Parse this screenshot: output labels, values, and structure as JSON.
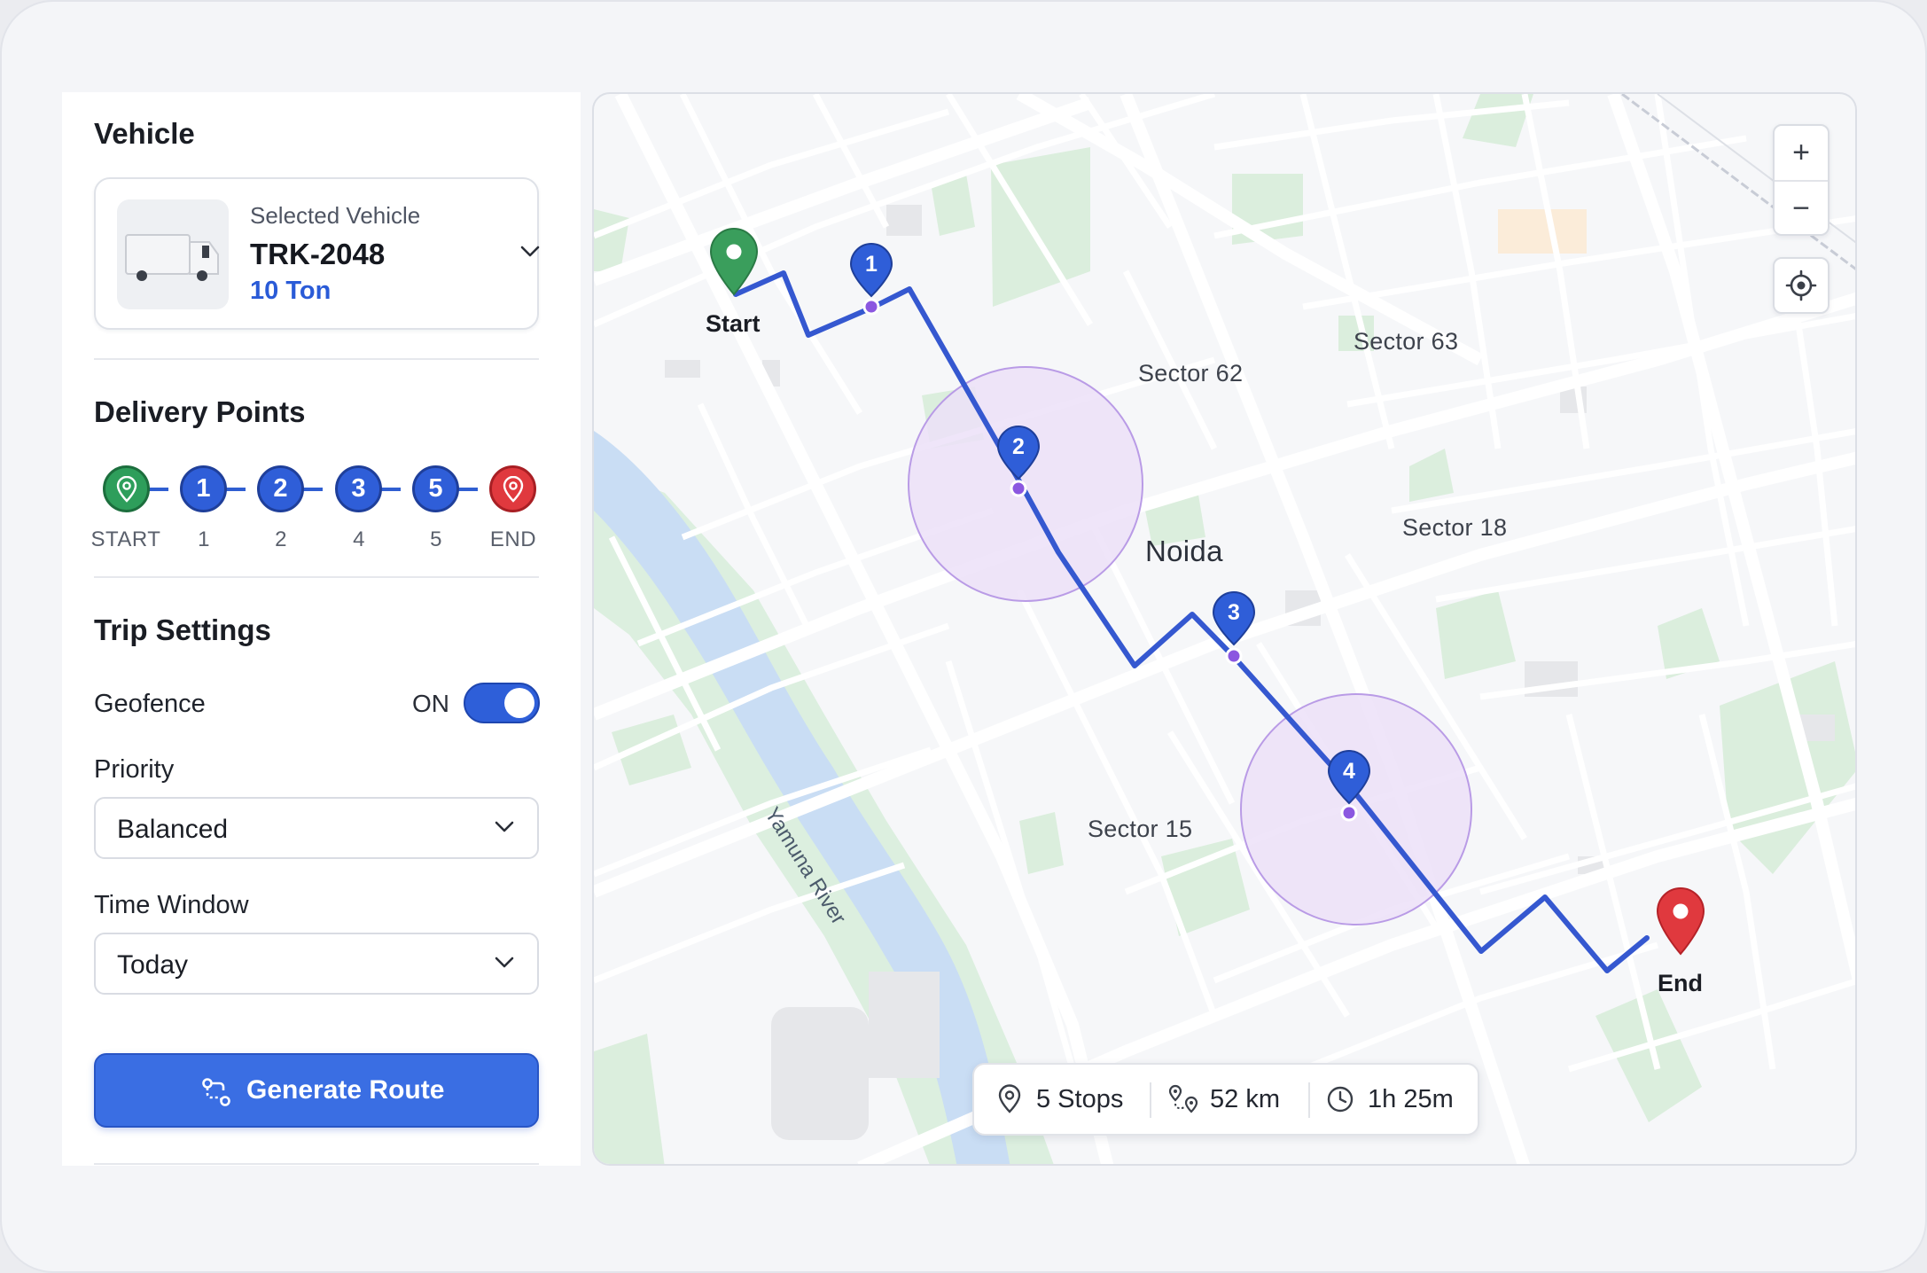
{
  "sidebar": {
    "vehicle_title": "Vehicle",
    "vehicle_card": {
      "label": "Selected Vehicle",
      "id": "TRK-2048",
      "capacity": "10 Ton",
      "thumb_icon": "truck-icon",
      "chevron_icon": "chevron-down-icon"
    },
    "delivery_title": "Delivery Points",
    "steps": [
      {
        "badge": "",
        "label": "START",
        "kind": "start"
      },
      {
        "badge": "1",
        "label": "1",
        "kind": "stop"
      },
      {
        "badge": "2",
        "label": "2",
        "kind": "stop"
      },
      {
        "badge": "3",
        "label": "4",
        "kind": "stop"
      },
      {
        "badge": "5",
        "label": "5",
        "kind": "stop"
      },
      {
        "badge": "",
        "label": "END",
        "kind": "end"
      }
    ],
    "trip_title": "Trip Settings",
    "geofence": {
      "label": "Geofence",
      "state": "ON",
      "on": true
    },
    "priority": {
      "label": "Priority",
      "value": "Balanced"
    },
    "time_window": {
      "label": "Time Window",
      "value": "Today"
    },
    "generate_button": "Generate Route"
  },
  "map": {
    "labels": {
      "sector62": "Sector 62",
      "sector63": "Sector 63",
      "noida": "Noida",
      "sector18": "Sector 18",
      "sector15": "Sector 15",
      "river": "Yamuna River"
    },
    "start_label": "Start",
    "end_label": "End",
    "markers": [
      "1",
      "2",
      "3",
      "4"
    ],
    "zoom_in": "+",
    "zoom_out": "−",
    "stats": {
      "stops": "5 Stops",
      "distance": "52 km",
      "duration": "1h 25m"
    }
  },
  "colors": {
    "accent": "#2f5ed8",
    "route": "#3558d0",
    "geofence": "#b99be6",
    "start": "#2e9e5b",
    "end": "#e0393e"
  }
}
